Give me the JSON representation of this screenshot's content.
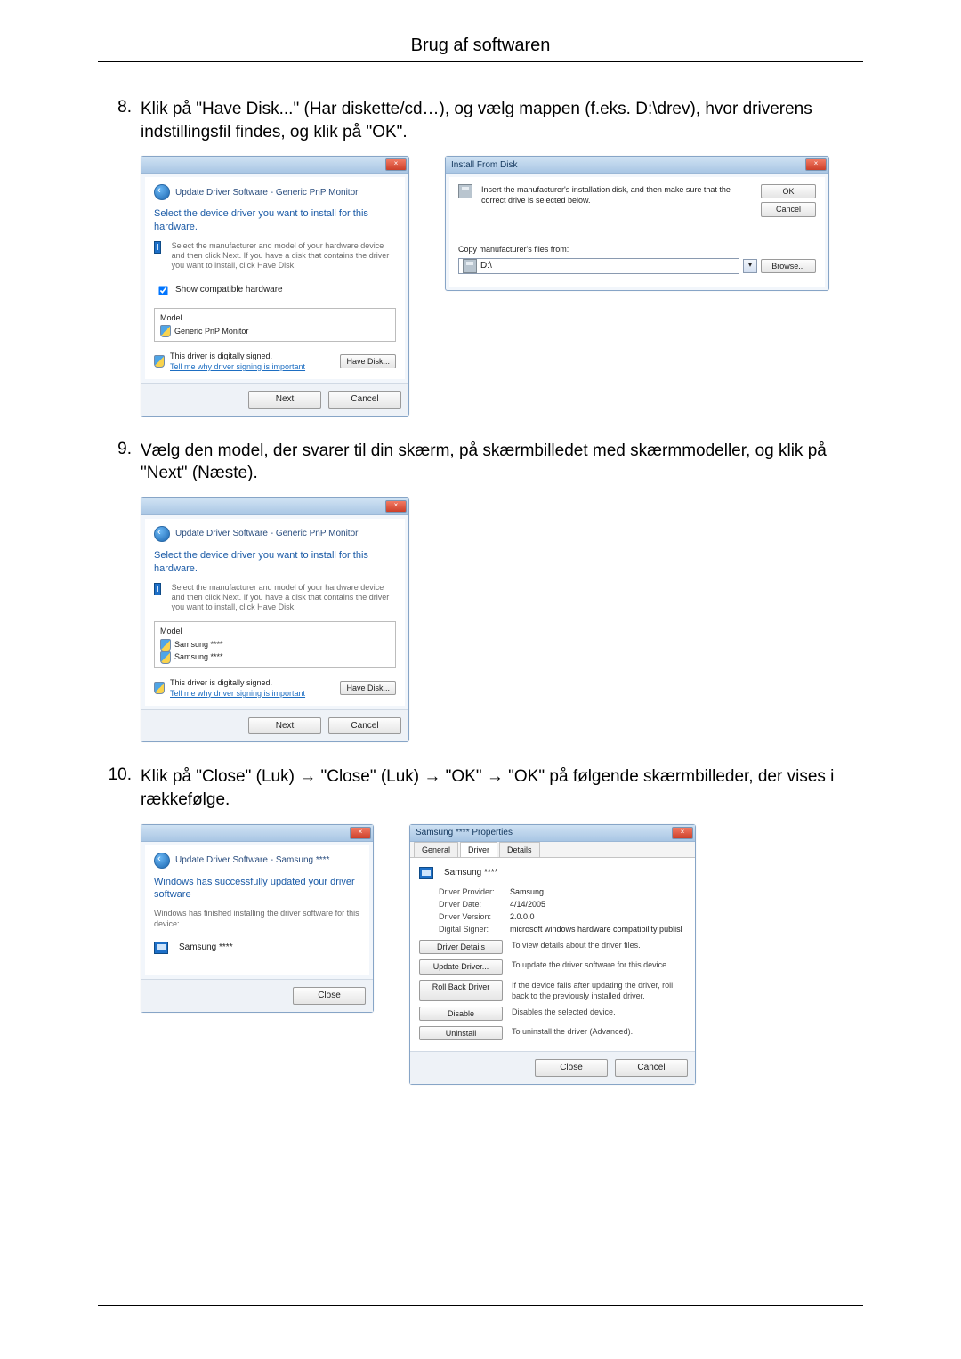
{
  "page_title": "Brug af softwaren",
  "steps": {
    "8": {
      "num": "8.",
      "text": "Klik på \"Have Disk...\" (Har diskette/cd…), og vælg mappen (f.eks. D:\\drev), hvor driverens indstillingsfil findes, og klik på \"OK\"."
    },
    "9": {
      "num": "9.",
      "text": "Vælg den model, der svarer til din skærm, på skærmbilledet med skærmmodeller, og klik på \"Next\" (Næste)."
    },
    "10": {
      "num": "10.",
      "text": "Klik på \"Close\" (Luk) → \"Close\" (Luk) → \"OK\" → \"OK\" på følgende skærmbilleder, der vises i rækkefølge."
    }
  },
  "dlg_update1": {
    "title": "Update Driver Software - Generic PnP Monitor",
    "heading": "Select the device driver you want to install for this hardware.",
    "hint": "Select the manufacturer and model of your hardware device and then click Next. If you have a disk that contains the driver you want to install, click Have Disk.",
    "show_compatible": "Show compatible hardware",
    "model_label": "Model",
    "model_item": "Generic PnP Monitor",
    "signed": "This driver is digitally signed.",
    "why": "Tell me why driver signing is important",
    "have_disk": "Have Disk...",
    "next": "Next",
    "cancel": "Cancel"
  },
  "dlg_ifd": {
    "title": "Install From Disk",
    "msg": "Insert the manufacturer's installation disk, and then make sure that the correct drive is selected below.",
    "ok": "OK",
    "cancel": "Cancel",
    "copy_label": "Copy manufacturer's files from:",
    "path": "D:\\",
    "browse": "Browse..."
  },
  "dlg_update2": {
    "title": "Update Driver Software - Generic PnP Monitor",
    "heading": "Select the device driver you want to install for this hardware.",
    "hint": "Select the manufacturer and model of your hardware device and then click Next. If you have a disk that contains the driver you want to install, click Have Disk.",
    "model_label": "Model",
    "model1": "Samsung ****",
    "model2": "Samsung ****",
    "signed": "This driver is digitally signed.",
    "why": "Tell me why driver signing is important",
    "have_disk": "Have Disk...",
    "next": "Next",
    "cancel": "Cancel"
  },
  "dlg_done": {
    "title": "Update Driver Software - Samsung ****",
    "heading": "Windows has successfully updated your driver software",
    "line": "Windows has finished installing the driver software for this device:",
    "device": "Samsung ****",
    "close": "Close"
  },
  "dlg_props": {
    "title": "Samsung **** Properties",
    "tabs": {
      "general": "General",
      "driver": "Driver",
      "details": "Details"
    },
    "device": "Samsung ****",
    "provider_k": "Driver Provider:",
    "provider_v": "Samsung",
    "date_k": "Driver Date:",
    "date_v": "4/14/2005",
    "version_k": "Driver Version:",
    "version_v": "2.0.0.0",
    "signer_k": "Digital Signer:",
    "signer_v": "microsoft windows hardware compatibility publisl",
    "btn_details": "Driver Details",
    "desc_details": "To view details about the driver files.",
    "btn_update": "Update Driver...",
    "desc_update": "To update the driver software for this device.",
    "btn_rollback": "Roll Back Driver",
    "desc_rollback": "If the device fails after updating the driver, roll back to the previously installed driver.",
    "btn_disable": "Disable",
    "desc_disable": "Disables the selected device.",
    "btn_uninstall": "Uninstall",
    "desc_uninstall": "To uninstall the driver (Advanced).",
    "close": "Close",
    "cancel": "Cancel"
  }
}
